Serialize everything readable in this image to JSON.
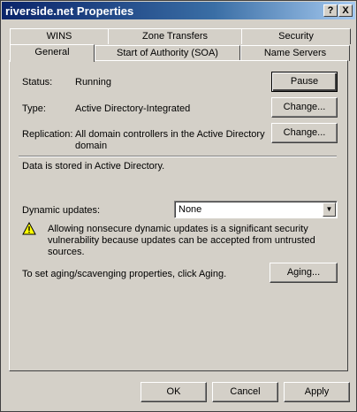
{
  "window": {
    "title": "riverside.net Properties",
    "help_btn": "?",
    "close_btn": "X"
  },
  "tabs": {
    "row_back": [
      "WINS",
      "Zone Transfers",
      "Security"
    ],
    "row_front": [
      "General",
      "Start of Authority (SOA)",
      "Name Servers"
    ],
    "active": "General"
  },
  "general": {
    "status_label": "Status:",
    "status_value": "Running",
    "pause_button": "Pause",
    "type_label": "Type:",
    "type_value": "Active Directory-Integrated",
    "type_change_button": "Change...",
    "replication_label": "Replication:",
    "replication_value_line1": "All domain controllers in the Active Directory",
    "replication_value_line2": "domain",
    "replication_change_button": "Change...",
    "data_stored_text": "Data is stored in Active Directory.",
    "dynamic_updates_label": "Dynamic updates:",
    "dynamic_updates_value": "None",
    "warning_line1": "Allowing nonsecure dynamic updates is a significant security",
    "warning_line2": "vulnerability because updates can be accepted from untrusted",
    "warning_line3": "sources.",
    "aging_text": "To set aging/scavenging properties, click Aging.",
    "aging_button": "Aging..."
  },
  "footer": {
    "ok": "OK",
    "cancel": "Cancel",
    "apply": "Apply"
  }
}
